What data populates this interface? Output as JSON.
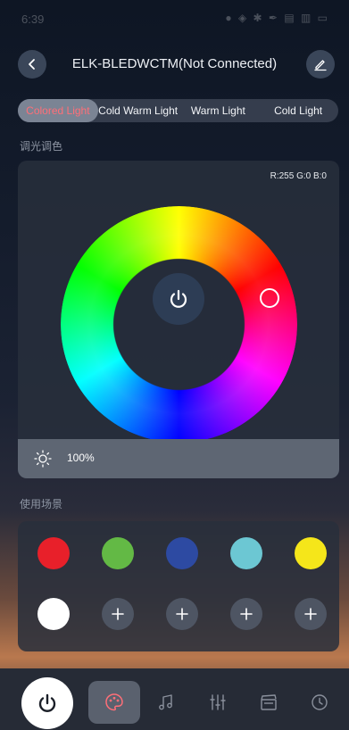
{
  "status_bar": {
    "time": "6:39",
    "icons": "● ◈ ✱ ✒ ▤ ▥ ▭"
  },
  "header": {
    "title": "ELK-BLEDWCTM(Not Connected)"
  },
  "tabs": [
    {
      "label": "Colored Light",
      "active": true
    },
    {
      "label": "Cold Warm Light",
      "active": false
    },
    {
      "label": "Warm Light",
      "active": false
    },
    {
      "label": "Cold Light",
      "active": false
    }
  ],
  "color_section": {
    "label": "调光调色",
    "rgb_readout": "R:255 G:0 B:0",
    "brightness": "100%"
  },
  "scenes_section": {
    "label": "使用场景",
    "colors": [
      "#e8202a",
      "#63b945",
      "#2d4aa2",
      "#6cc7d3",
      "#f5e61a",
      "#ffffff"
    ],
    "add_slots": 4
  },
  "accent_color": "#ff6f78"
}
